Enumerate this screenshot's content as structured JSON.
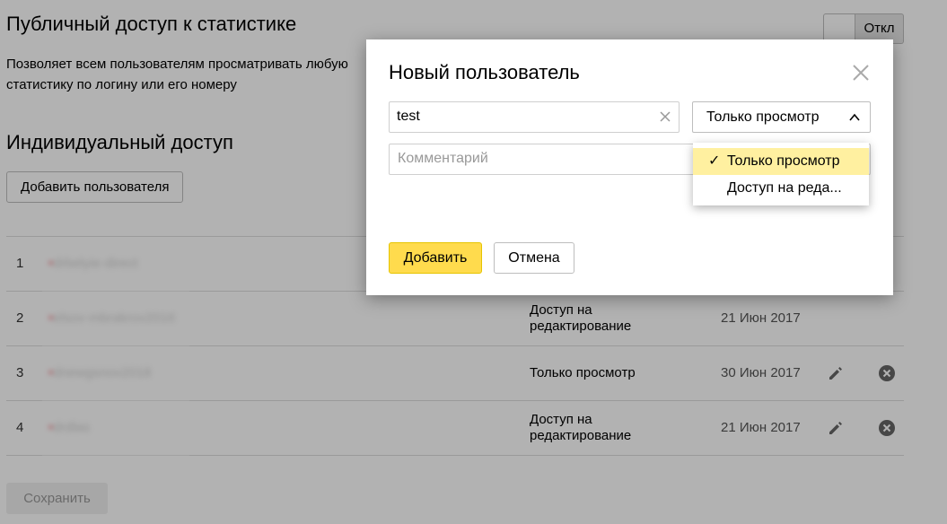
{
  "public_access": {
    "title": "Публичный доступ к статистике",
    "description": "Позволяет всем пользователям просматривать любую статистику по логину или его номеру",
    "toggle_label": "Откл"
  },
  "individual_access": {
    "title": "Индивидуальный доступ",
    "add_user_label": "Добавить пользователя"
  },
  "table": {
    "rows": [
      {
        "num": "1",
        "user": "drbelyie-direct",
        "access": "",
        "date": ""
      },
      {
        "num": "2",
        "user": "elsov-mbrakrov2016",
        "access": "Доступ на редактирование",
        "date": "21 Июн 2017"
      },
      {
        "num": "3",
        "user": "dnewgsnov2018",
        "access": "Только просмотр",
        "date": "30 Июн 2017"
      },
      {
        "num": "4",
        "user": "drdlas",
        "access": "Доступ на редактирование",
        "date": "21 Июн 2017"
      }
    ]
  },
  "save_label": "Сохранить",
  "modal": {
    "title": "Новый пользователь",
    "user_value": "test",
    "comment_placeholder": "Комментарий",
    "select_value": "Только просмотр",
    "menu": {
      "check": "✓",
      "items": [
        "Только просмотр",
        "Доступ на реда..."
      ]
    },
    "ok_label": "Добавить",
    "cancel_label": "Отмена"
  },
  "colors": {
    "accent": "#ffdb4d",
    "menu_selected": "#fff0a0",
    "overlay": "rgba(0,0,0,0.3)"
  },
  "icons": [
    "close-icon",
    "clear-icon",
    "chevron-up-icon",
    "pencil-icon",
    "delete-icon"
  ]
}
